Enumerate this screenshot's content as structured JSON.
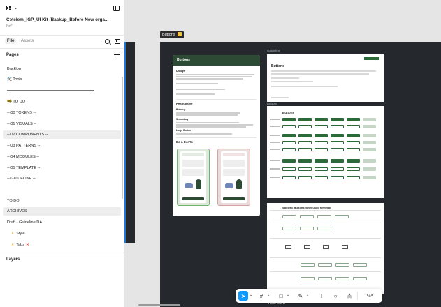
{
  "sidebar": {
    "file_title": "Cetelem_IGP_UI Kit (Backup_Before New orga...",
    "file_subtitle": "IGP",
    "tabs": [
      {
        "label": "File",
        "active": true
      },
      {
        "label": "Assets",
        "active": false
      }
    ],
    "pages_heading": "Pages",
    "pages": [
      "Backlog",
      "🛠️ Tools",
      "🚧 TO DO",
      "-- 00 TOKENS --",
      "-- 01 VISUALS --",
      "-- 02 COMPONENTS --",
      "-- 03 PATTERNS --",
      "-- 04 MODULES --",
      "-- 05 TEMPLATE --",
      "-- GUIDELINE --",
      "TO DO",
      "ARCHIVES",
      "Draft - Guideline DA"
    ],
    "sub_pages": [
      "Style",
      "Tabs"
    ],
    "layers_heading": "Layers"
  },
  "canvas": {
    "frame_label": "Buttons",
    "doc_card": {
      "header": "Buttons",
      "sections": [
        "Usage",
        "Responsive",
        "Do & Don'ts"
      ],
      "sub_sections": [
        "Primary",
        "Secondary",
        "Large Button"
      ]
    },
    "guideline_label": "Guideline",
    "guideline_title": "Buttons",
    "buttons_label": "Buttons",
    "buttons_frame_title": "Buttons",
    "specific_title": "Specific Buttons (only used for web)",
    "close_label": "Close Button"
  },
  "toolbar": {
    "tools": [
      "move-tool",
      "frame-tool",
      "shape-tool",
      "pen-tool",
      "text-tool",
      "comment-tool",
      "actions-tool",
      "dev-mode-toggle"
    ]
  },
  "colors": {
    "accent": "#0d99ff",
    "brand_green": "#2d4a35",
    "canvas_frame": "#25292e"
  }
}
